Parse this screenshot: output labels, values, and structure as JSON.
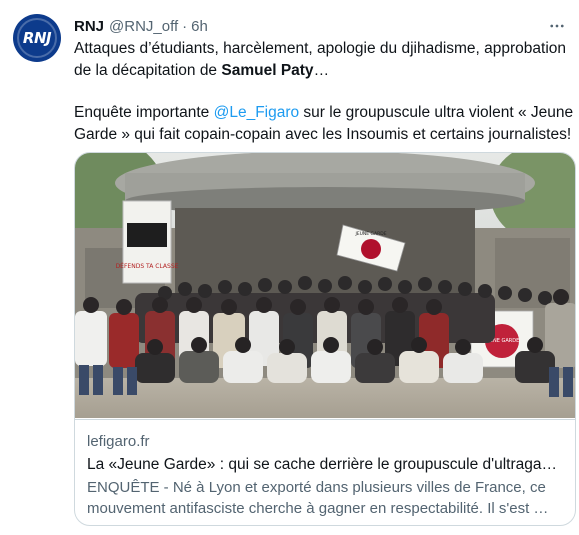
{
  "tweet": {
    "author": {
      "name": "RNJ",
      "handle": "@RNJ_off",
      "avatar_text": "RNJ"
    },
    "separator": "·",
    "timestamp": "6h",
    "more_icon": "more-horizontal-icon",
    "body": {
      "line1_pre": "Attaques d’étudiants, harcèlement, apologie du djihadisme, approbation de la décapitation de ",
      "line1_bold": "Samuel Paty",
      "line1_post": "…",
      "line2_pre": "Enquête importante ",
      "line2_mention": "@Le_Figaro",
      "line2_post": " sur le groupuscule ultra violent « Jeune Garde » qui fait copain-copain avec les Insoumis et certains journalistes!"
    },
    "card": {
      "domain": "lefigaro.fr",
      "title": "La «Jeune Garde» : qui se cache derrière le groupuscule d'ultragauche…",
      "description": "ENQUÊTE - Né à Lyon et exporté dans plusieurs villes de France, ce mouvement antifasciste cherche à gagner en respectabilité. Il s'est …",
      "image": {
        "banner_left": "DÉFENDS TA CLASSE",
        "flag_right": "JEUNE GARDE",
        "sign_right": "JEUNE GARDE"
      }
    }
  },
  "colors": {
    "text": "#0f1419",
    "secondary": "#536471",
    "link": "#1d9bf0",
    "border": "#cfd9de",
    "avatar_bg": "#0d3b8c"
  }
}
